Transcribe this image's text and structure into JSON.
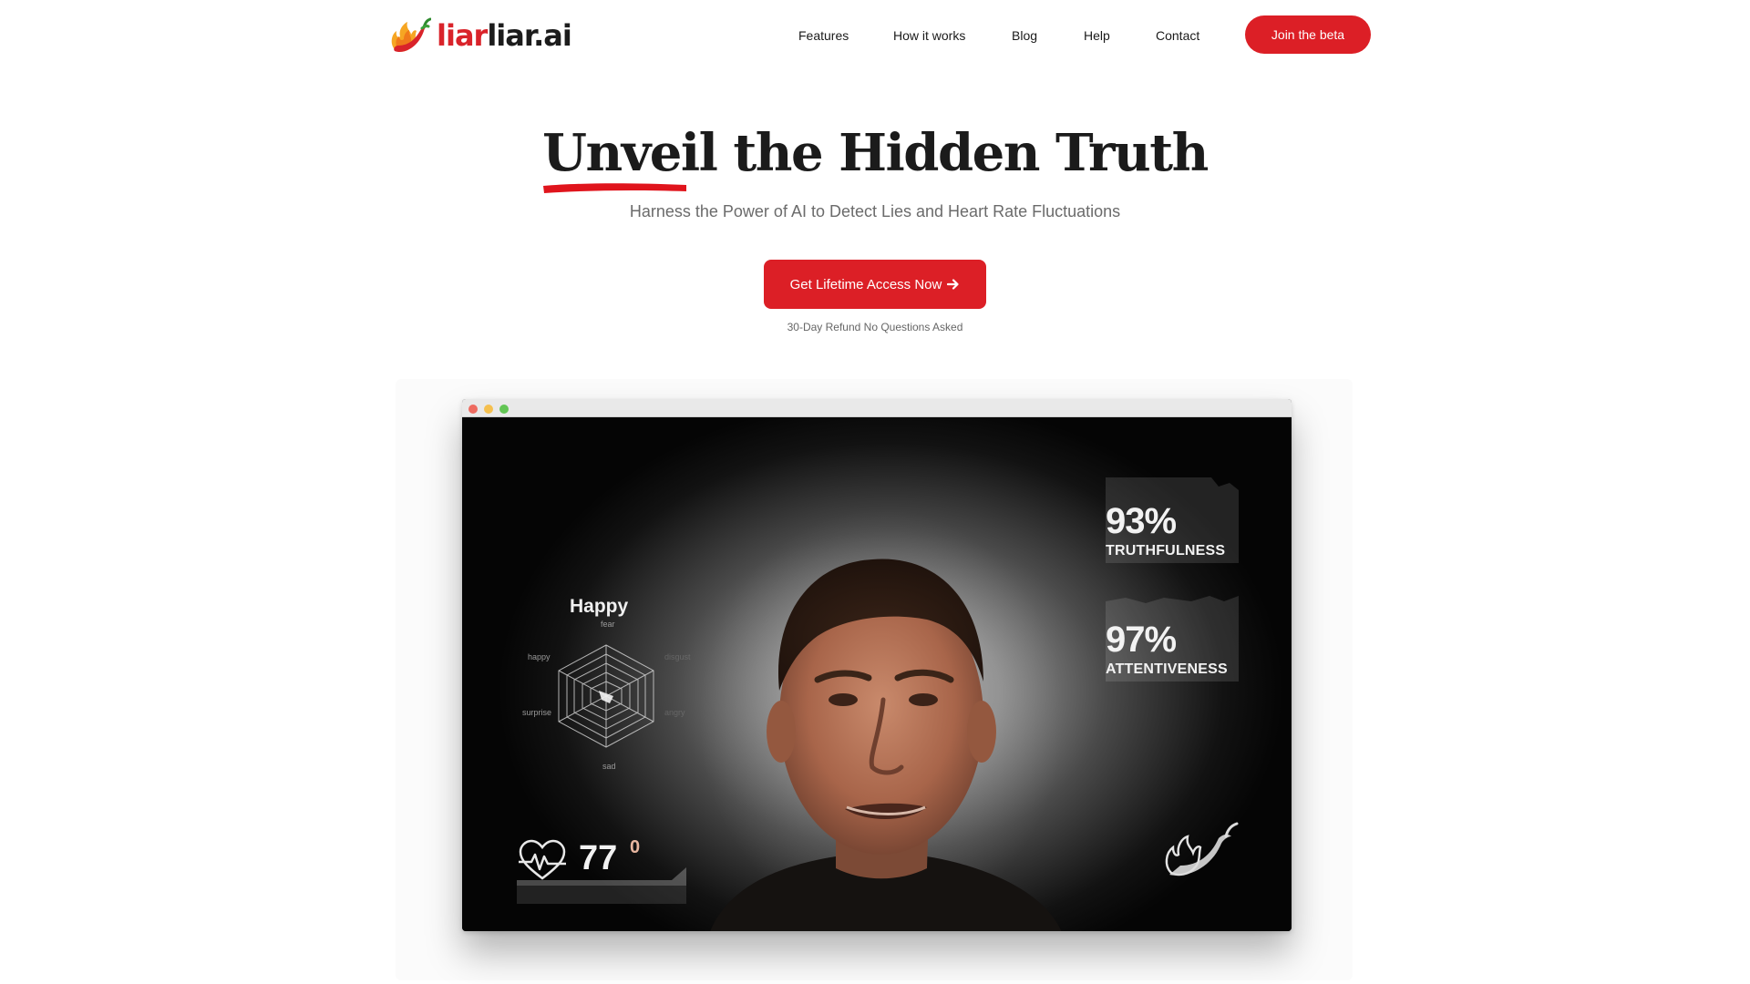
{
  "header": {
    "logo_part1": "liar",
    "logo_part2": "liar.ai",
    "nav": [
      "Features",
      "How it works",
      "Blog",
      "Help",
      "Contact"
    ],
    "beta_button": "Join the beta"
  },
  "hero": {
    "title_highlight": "Unveil",
    "title_rest": " the Hidden Truth",
    "subtitle": "Harness the Power of AI to Detect Lies and Heart Rate Fluctuations",
    "cta_label": "Get Lifetime Access Now",
    "refund_note": "30-Day Refund No Questions Asked"
  },
  "demo": {
    "emotion": "Happy",
    "radar_labels": {
      "top": "fear",
      "upper_right": "disgust",
      "lower_right": "angry",
      "bottom": "sad",
      "lower_left": "surprise",
      "upper_left": "happy"
    },
    "truthfulness": {
      "value": "93%",
      "label": "TRUTHFULNESS"
    },
    "attentiveness": {
      "value": "97%",
      "label": "ATTENTIVENESS"
    },
    "heart_rate": {
      "value": "77",
      "delta": "0"
    }
  },
  "colors": {
    "brand_red": "#dc1f26",
    "text_dark": "#1b1b1b",
    "subtitle_gray": "#6b6b6b"
  },
  "icons": [
    "chili-flame-logo-icon",
    "arrow-right-icon",
    "heart-pulse-icon",
    "chili-watermark-icon"
  ]
}
